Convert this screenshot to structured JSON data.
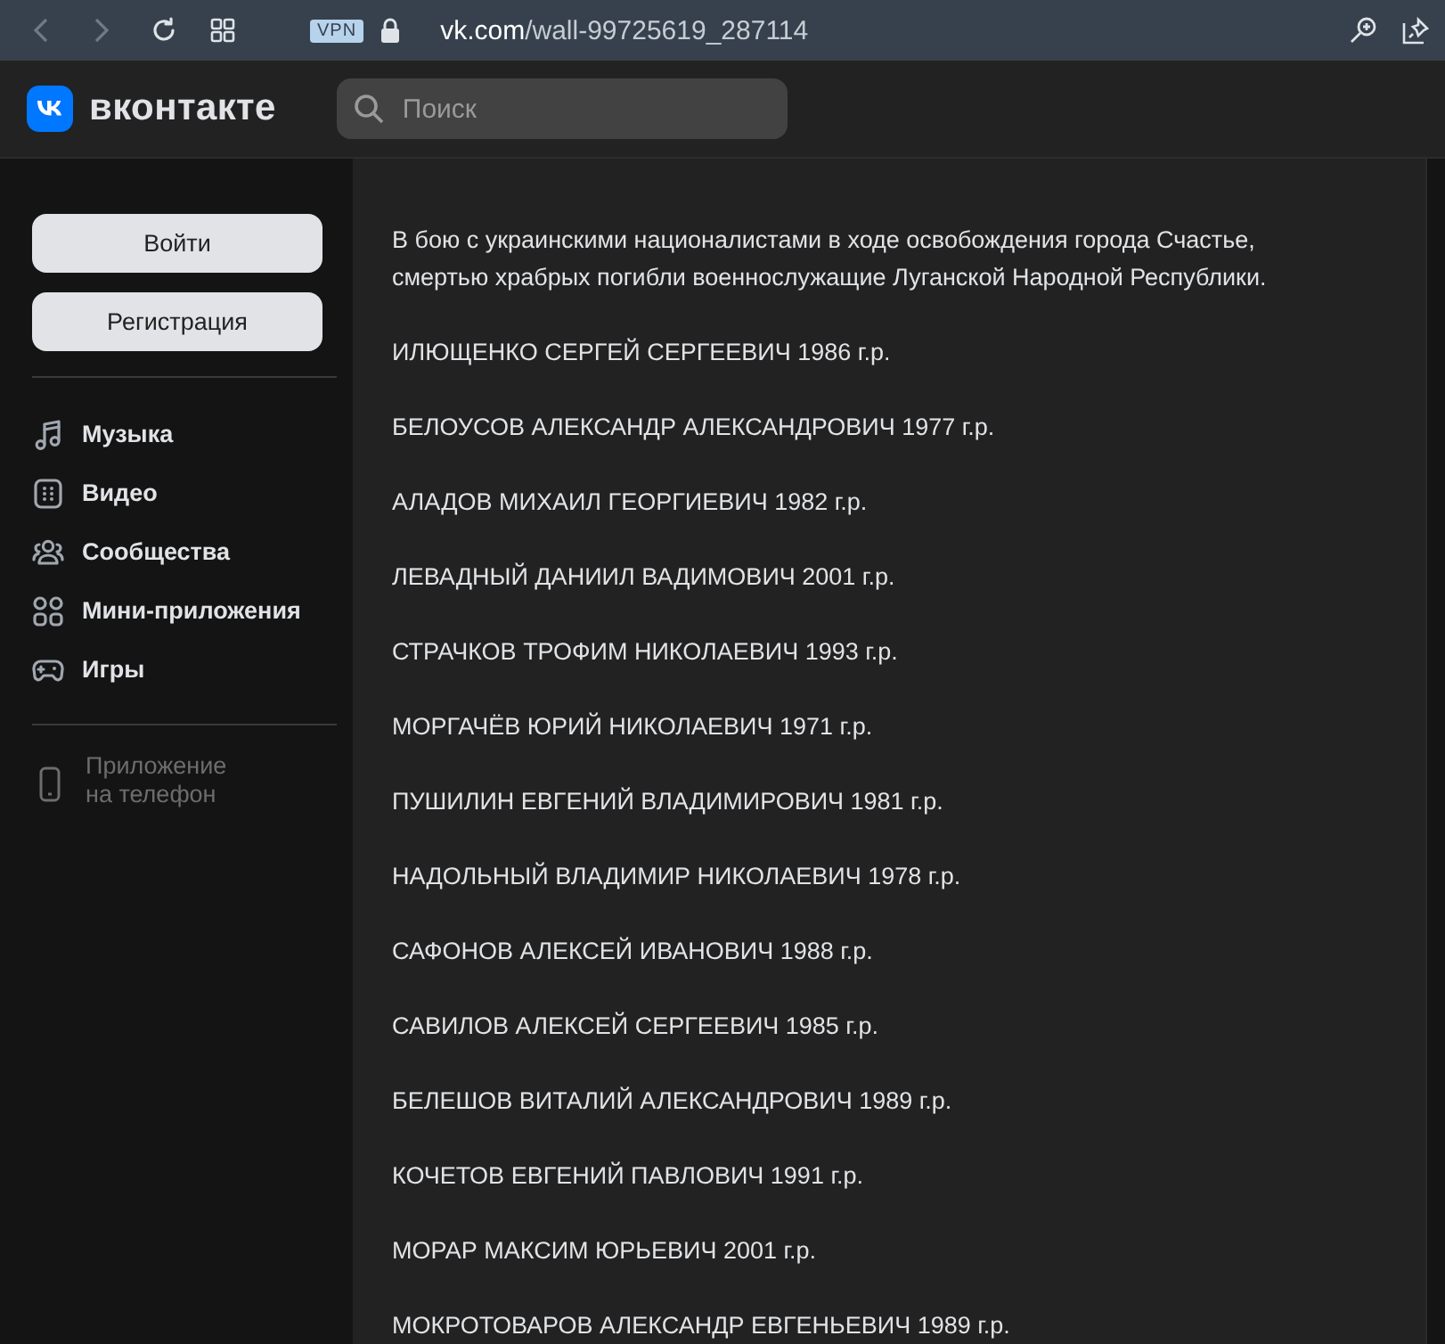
{
  "browser": {
    "vpn_badge": "VPN",
    "url_host": "vk.com",
    "url_path": "/wall-99725619_287114"
  },
  "header": {
    "logo_text": "вконтакте",
    "search": {
      "placeholder": "Поиск"
    }
  },
  "sidebar": {
    "buttons": [
      "Войти",
      "Регистрация"
    ],
    "items": [
      {
        "kind": "music",
        "label": "Музыка"
      },
      {
        "kind": "video",
        "label": "Видео"
      },
      {
        "kind": "groups",
        "label": "Сообщества"
      },
      {
        "kind": "apps",
        "label": "Мини-приложения"
      },
      {
        "kind": "games",
        "label": "Игры"
      }
    ],
    "app_link": {
      "label": "Приложение на телефон",
      "disabled": true
    }
  },
  "post": {
    "paragraph": "В бою с украинскими националистами в ходе освобождения города Счастье, смертью храбрых погибли военнослужащие Луганской Народной Республики.",
    "names": [
      "ИЛЮЩЕНКО СЕРГЕЙ СЕРГЕЕВИЧ 1986 г.р.",
      "БЕЛОУСОВ АЛЕКСАНДР АЛЕКСАНДРОВИЧ 1977 г.р.",
      "АЛАДОВ МИХАИЛ ГЕОРГИЕВИЧ 1982 г.р.",
      "ЛЕВАДНЫЙ ДАНИИЛ ВАДИМОВИЧ 2001 г.р.",
      "СТРАЧКОВ ТРОФИМ НИКОЛАЕВИЧ 1993 г.р.",
      "МОРГАЧЁВ ЮРИЙ НИКОЛАЕВИЧ 1971 г.р.",
      "ПУШИЛИН ЕВГЕНИЙ ВЛАДИМИРОВИЧ 1981 г.р.",
      "НАДОЛЬНЫЙ ВЛАДИМИР НИКОЛАЕВИЧ 1978 г.р.",
      "САФОНОВ АЛЕКСЕЙ ИВАНОВИЧ 1988 г.р.",
      "САВИЛОВ АЛЕКСЕЙ СЕРГЕЕВИЧ 1985 г.р.",
      "БЕЛЕШОВ ВИТАЛИЙ АЛЕКСАНДРОВИЧ 1989 г.р.",
      "КОЧЕТОВ ЕВГЕНИЙ ПАВЛОВИЧ 1991 г.р.",
      "МОРАР МАКСИМ ЮРЬЕВИЧ 2001 г.р.",
      "МОКРОТОВАРОВ АЛЕКСАНДР ЕВГЕНЬЕВИЧ 1989 г.р."
    ]
  }
}
